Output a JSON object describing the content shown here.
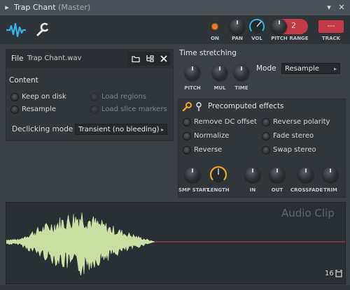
{
  "window": {
    "title": "Trap Chant",
    "subtitle": "(Master)",
    "collapse": "▸",
    "menu": "▾",
    "close": "✕"
  },
  "toolbar": {
    "on_label": "ON",
    "pan_label": "PAN",
    "vol_label": "VOL",
    "pitch_label": "PITCH",
    "range_label": "RANGE",
    "range_value": "2",
    "track_label": "TRACK",
    "track_value": "---"
  },
  "file": {
    "label": "File",
    "name": "Trap Chant.wav"
  },
  "content": {
    "title": "Content",
    "keep_on_disk": "Keep on disk",
    "resample": "Resample",
    "load_regions": "Load regions",
    "load_slice_markers": "Load slice markers",
    "declicking_label": "Declicking mode",
    "declicking_value": "Transient (no bleeding)"
  },
  "time_stretching": {
    "title": "Time stretching",
    "pitch": "PITCH",
    "mul": "MUL",
    "time": "TIME",
    "mode_label": "Mode",
    "mode_value": "Resample"
  },
  "precomputed": {
    "title": "Precomputed effects",
    "remove_dc": "Remove DC offset",
    "normalize": "Normalize",
    "reverse": "Reverse",
    "reverse_polarity": "Reverse polarity",
    "fade_stereo": "Fade stereo",
    "swap_stereo": "Swap stereo",
    "knobs": [
      "SMP START",
      "LENGTH",
      "IN",
      "OUT",
      "CROSSFADE",
      "TRIM"
    ]
  },
  "clip": {
    "watermark": "Audio Clip",
    "count": "16"
  },
  "colors": {
    "accent_blue": "#32b4e6",
    "orange": "#f5a623",
    "red": "#c23b46"
  }
}
